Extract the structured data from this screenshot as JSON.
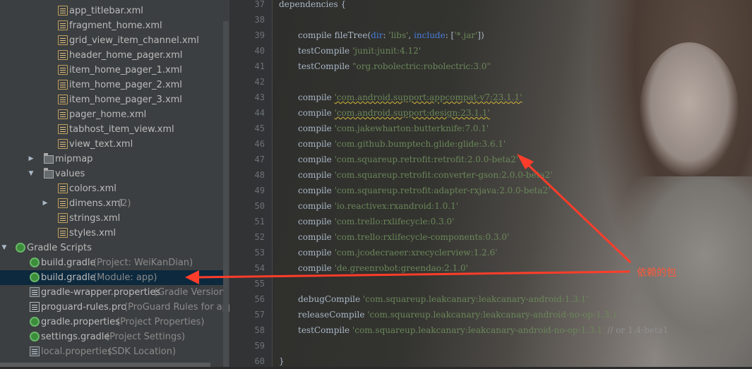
{
  "tree": {
    "items": [
      {
        "label": "app_titlebar.xml",
        "hint": "",
        "icon": "xml-file-icon"
      },
      {
        "label": "fragment_home.xml",
        "hint": "",
        "icon": "xml-file-icon"
      },
      {
        "label": "grid_view_item_channel.xml",
        "hint": "",
        "icon": "xml-file-icon"
      },
      {
        "label": "header_home_pager.xml",
        "hint": "",
        "icon": "xml-file-icon"
      },
      {
        "label": "item_home_pager_1.xml",
        "hint": "",
        "icon": "xml-file-icon"
      },
      {
        "label": "item_home_pager_2.xml",
        "hint": "",
        "icon": "xml-file-icon"
      },
      {
        "label": "item_home_pager_3.xml",
        "hint": "",
        "icon": "xml-file-icon"
      },
      {
        "label": "pager_home.xml",
        "hint": "",
        "icon": "xml-file-icon"
      },
      {
        "label": "tabhost_item_view.xml",
        "hint": "",
        "icon": "xml-file-icon"
      },
      {
        "label": "view_text.xml",
        "hint": "",
        "icon": "xml-file-icon"
      },
      {
        "label": "mipmap",
        "hint": "",
        "icon": "folder-icon"
      },
      {
        "label": "values",
        "hint": "",
        "icon": "folder-icon"
      },
      {
        "label": "colors.xml",
        "hint": "",
        "icon": "xml-file-icon"
      },
      {
        "label": "dimens.xml",
        "hint": "(2)",
        "icon": "xml-file-icon"
      },
      {
        "label": "strings.xml",
        "hint": "",
        "icon": "xml-file-icon"
      },
      {
        "label": "styles.xml",
        "hint": "",
        "icon": "xml-file-icon"
      },
      {
        "label": "Gradle Scripts",
        "hint": "",
        "icon": "gradle-icon"
      },
      {
        "label": "build.gradle",
        "hint": "(Project: WeiKanDian)",
        "icon": "gradle-icon"
      },
      {
        "label": "build.gradle",
        "hint": "(Module: app)",
        "icon": "gradle-icon"
      },
      {
        "label": "gradle-wrapper.properties",
        "hint": "(Gradle Version)",
        "icon": "properties-icon"
      },
      {
        "label": "proguard-rules.pro",
        "hint": "(ProGuard Rules for app)",
        "icon": "pro-file-icon"
      },
      {
        "label": "gradle.properties",
        "hint": "(Project Properties)",
        "icon": "gradle-icon"
      },
      {
        "label": "settings.gradle",
        "hint": "(Project Settings)",
        "icon": "gradle-icon"
      },
      {
        "label": "local.properties",
        "hint": "(SDK Location)",
        "icon": "properties-icon"
      }
    ],
    "arrows": [
      "▶",
      "▼",
      "▶",
      "▼"
    ]
  },
  "editor": {
    "line_numbers": [
      "37",
      "38",
      "39",
      "40",
      "41",
      "42",
      "43",
      "44",
      "45",
      "46",
      "47",
      "48",
      "49",
      "50",
      "51",
      "52",
      "53",
      "54",
      "55",
      "56",
      "57",
      "58",
      "59",
      "60"
    ],
    "lines": {
      "l37": "dependencies {",
      "l39a": "compile fileTree(",
      "l39b": "dir",
      "l39c": ": ",
      "l39d": "'libs'",
      "l39e": ", ",
      "l39f": "include",
      "l39g": ": [",
      "l39h": "'*.jar'",
      "l39i": "])",
      "l40a": "testCompile ",
      "l40b": "'junit:junit:4.12'",
      "l41a": "testCompile ",
      "l41b": "\"org.robolectric:robolectric:3.0\"",
      "l43a": "compile ",
      "l43b": "'com.android.support:appcompat-v7:23.1.1'",
      "l44a": "compile ",
      "l44b": "'com.android.support:design:23.1.1'",
      "l45a": "compile ",
      "l45b": "'com.jakewharton:butterknife:7.0.1'",
      "l46a": "compile ",
      "l46b": "'com.github.bumptech.glide:glide:3.6.1'",
      "l47a": "compile ",
      "l47b": "'com.squareup.retrofit:retrofit:2.0.0-beta2'",
      "l48a": "compile ",
      "l48b": "'com.squareup.retrofit:converter-gson:2.0.0-beta2'",
      "l49a": "compile ",
      "l49b": "'com.squareup.retrofit:adapter-rxjava:2.0.0-beta2'",
      "l50a": "compile ",
      "l50b": "'io.reactivex:rxandroid:1.0.1'",
      "l51a": "compile ",
      "l51b": "'com.trello:rxlifecycle:0.3.0'",
      "l52a": "compile ",
      "l52b": "'com.trello:rxlifecycle-components:0.3.0'",
      "l53a": "compile ",
      "l53b": "'com.jcodecraeer:xrecyclerview:1.2.6'",
      "l54a": "compile ",
      "l54b": "'de.greenrobot:greendao:2.1.0'",
      "l56a": "debugCompile ",
      "l56b": "'com.squareup.leakcanary:leakcanary-android:1.3.1'",
      "l57a": "releaseCompile ",
      "l57b": "'com.squareup.leakcanary:leakcanary-android-no-op:1.3.1'",
      "l58a": "testCompile ",
      "l58b": "'com.squareup.leakcanary:leakcanary-android-no-op:1.3.1'",
      "l58c": " // or 1.4-beta1",
      "l60": "}"
    }
  },
  "annotation": {
    "text": "依赖的包",
    "color": "#ff4a2a"
  },
  "colors": {
    "selection": "#0d293e",
    "string": "#6a8759",
    "attr": "#467cda"
  }
}
